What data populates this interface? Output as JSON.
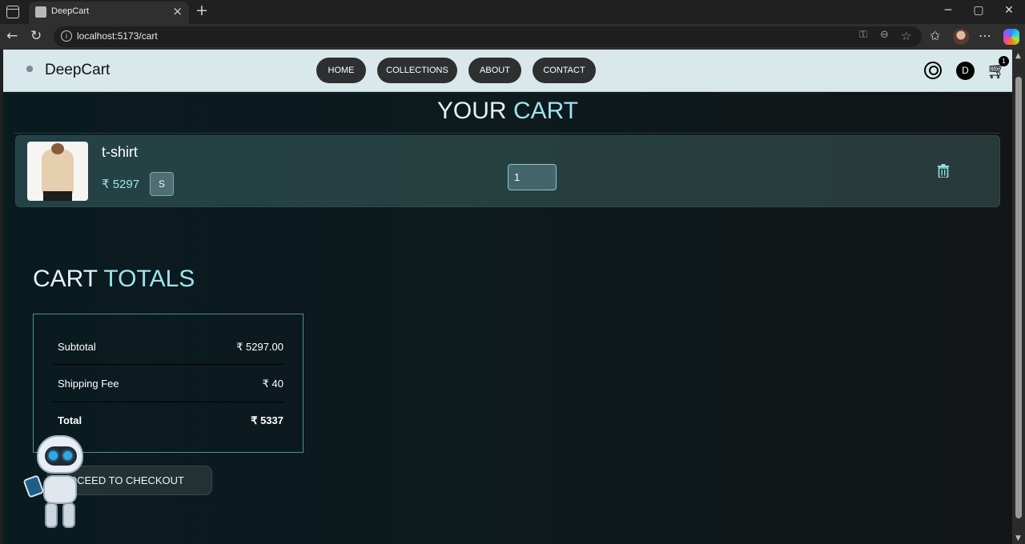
{
  "browser": {
    "tab_title": "DeepCart",
    "url": "localhost:5173/cart"
  },
  "site": {
    "brand": "DeepCart",
    "nav": [
      "HOME",
      "COLLECTIONS",
      "ABOUT",
      "CONTACT"
    ],
    "avatar_initial": "D",
    "cart_count": "1"
  },
  "cart": {
    "title_part1": "YOUR",
    "title_part2": "CART",
    "items": [
      {
        "name": "t-shirt",
        "price": "₹ 5297",
        "size": "S",
        "quantity": "1"
      }
    ]
  },
  "totals": {
    "title_part1": "CART",
    "title_part2": "TOTALS",
    "subtotal_label": "Subtotal",
    "subtotal_value": "₹ 5297.00",
    "shipping_label": "Shipping Fee",
    "shipping_value": "₹ 40",
    "total_label": "Total",
    "total_value": "₹ 5337"
  },
  "checkout_label": "OCEED TO CHECKOUT",
  "colors": {
    "accent_cyan": "#9fe3ef",
    "nav_bg": "#d9e8ea",
    "page_bg": "#0d1a1e",
    "button_dark": "#2d2f31"
  }
}
